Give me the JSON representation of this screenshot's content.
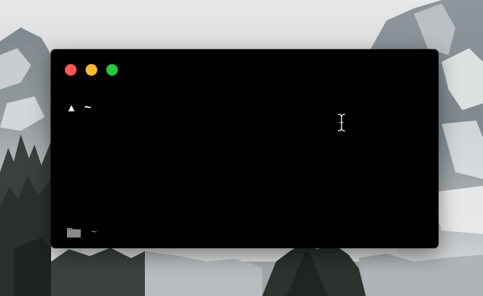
{
  "window": {
    "traffic_lights": [
      "close",
      "minimize",
      "zoom"
    ],
    "colors": {
      "background": "#000000",
      "close": "#fd5b58",
      "minimize": "#fdbc30",
      "zoom": "#2ac840"
    }
  },
  "prompt": {
    "symbol": "▲",
    "directory": "~"
  },
  "status_bar": {
    "icon": "folder-icon",
    "path": "~"
  },
  "cursor": {
    "icon": "text-cursor-icon"
  }
}
